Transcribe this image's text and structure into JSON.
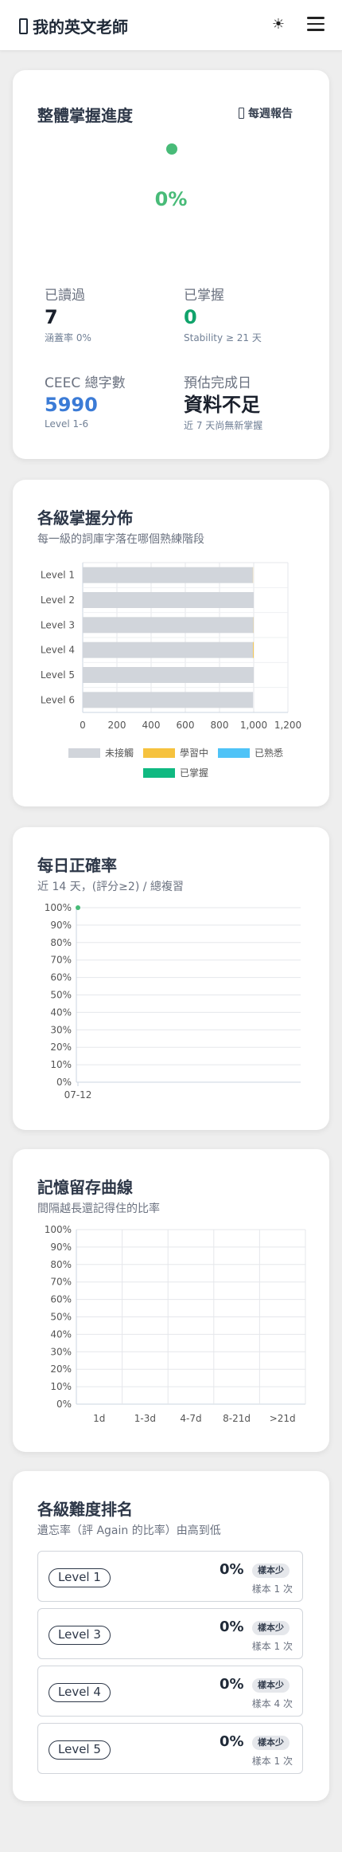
{
  "header": {
    "title": "我的英文老師",
    "theme_icon": "☀",
    "menu_icon": "hamburger"
  },
  "overview": {
    "title": "整體掌握進度",
    "weekly_report": "每週報告",
    "progress_text": "0%",
    "progress_value": 0,
    "stats": [
      {
        "label": "已讀過",
        "value": "7",
        "note": "涵蓋率 0%"
      },
      {
        "label": "已掌握",
        "value": "0",
        "note": "Stability ≥ 21 天"
      },
      {
        "label": "CEEC 總字數",
        "value": "5990",
        "note": "Level 1-6"
      },
      {
        "label": "預估完成日",
        "value": "資料不足",
        "note": "近 7 天尚無新掌握"
      }
    ],
    "colors": {
      "progress": "#48bb78",
      "mastered": "#10a36b",
      "total": "#3b7bd6"
    }
  },
  "distribution": {
    "title": "各級掌握分佈",
    "subtitle": "每一級的詞庫字落在哪個熟練階段",
    "legend": [
      {
        "label": "未接觸",
        "color": "#d1d5db"
      },
      {
        "label": "學習中",
        "color": "#f6c23e"
      },
      {
        "label": "已熟悉",
        "color": "#4fc3f7"
      },
      {
        "label": "已掌握",
        "color": "#10b981"
      }
    ]
  },
  "daily_accuracy": {
    "title": "每日正確率",
    "subtitle": "近 14 天，(評分≥2) / 總複習"
  },
  "retention": {
    "title": "記憶留存曲線",
    "subtitle": "間隔越長還記得住的比率"
  },
  "difficulty": {
    "title": "各級難度排名",
    "subtitle": "遺忘率（評 Again 的比率）由高到低",
    "rows": [
      {
        "level": "Level 1",
        "pct": "0%",
        "badge": "樣本少",
        "sample": "樣本 1 次"
      },
      {
        "level": "Level 3",
        "pct": "0%",
        "badge": "樣本少",
        "sample": "樣本 1 次"
      },
      {
        "level": "Level 4",
        "pct": "0%",
        "badge": "樣本少",
        "sample": "樣本 4 次"
      },
      {
        "level": "Level 5",
        "pct": "0%",
        "badge": "樣本少",
        "sample": "樣本 1 次"
      }
    ]
  },
  "chart_data": [
    {
      "type": "bar",
      "orientation": "horizontal",
      "stacked": true,
      "categories": [
        "Level 1",
        "Level 2",
        "Level 3",
        "Level 4",
        "Level 5",
        "Level 6"
      ],
      "series": [
        {
          "name": "未接觸",
          "values": [
            995,
            1000,
            999,
            996,
            1000,
            996
          ]
        },
        {
          "name": "學習中",
          "values": [
            1,
            0,
            1,
            4,
            0,
            0
          ]
        },
        {
          "name": "已熟悉",
          "values": [
            0,
            0,
            0,
            0,
            0,
            0
          ]
        },
        {
          "name": "已掌握",
          "values": [
            0,
            0,
            0,
            0,
            0,
            0
          ]
        }
      ],
      "xlim": [
        0,
        1200
      ],
      "xticks": [
        "0",
        "200",
        "400",
        "600",
        "800",
        "1,000",
        "1,200"
      ],
      "grid": true,
      "legend": "bottom"
    },
    {
      "type": "line",
      "x": [
        "07-12"
      ],
      "series": [
        {
          "values": [
            100
          ]
        }
      ],
      "ylim": [
        0,
        100
      ],
      "yticks": [
        "0%",
        "10%",
        "20%",
        "30%",
        "40%",
        "50%",
        "60%",
        "70%",
        "80%",
        "90%",
        "100%"
      ],
      "grid": true,
      "color": "#48bb78"
    },
    {
      "type": "bar",
      "categories": [
        "1d",
        "1-3d",
        "4-7d",
        "8-21d",
        ">21d"
      ],
      "series": [
        {
          "values": [
            0,
            0,
            0,
            0,
            0
          ]
        }
      ],
      "ylim": [
        0,
        100
      ],
      "yticks": [
        "0%",
        "10%",
        "20%",
        "30%",
        "40%",
        "50%",
        "60%",
        "70%",
        "80%",
        "90%",
        "100%"
      ],
      "grid": true
    }
  ]
}
